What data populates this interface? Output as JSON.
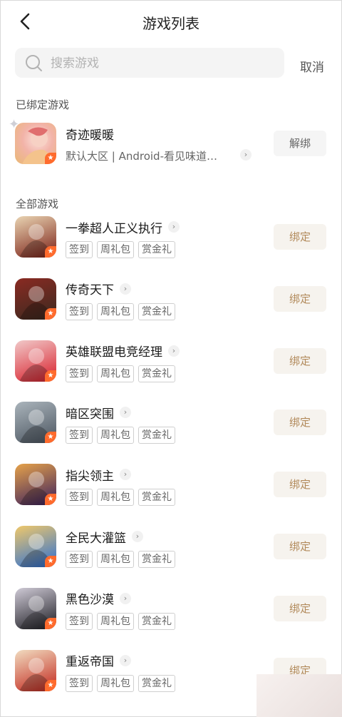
{
  "header": {
    "title": "游戏列表",
    "back_icon": "chevron-left-icon"
  },
  "search": {
    "placeholder": "搜索游戏",
    "value": "",
    "cancel_label": "取消"
  },
  "bound_section": {
    "title": "已绑定游戏",
    "game": {
      "name": "奇迹暖暖",
      "subtitle": "默认大区 | Android-看见味道…",
      "button": "解绑",
      "chevron": "›"
    }
  },
  "all_section": {
    "title": "全部游戏",
    "games": [
      {
        "name": "一拳超人正义执行",
        "chevron": "›",
        "tags": [
          "签到",
          "周礼包",
          "赏金礼"
        ],
        "button": "绑定",
        "icon_colors": [
          "#7a1f16",
          "#e9d4b2"
        ]
      },
      {
        "name": "传奇天下",
        "chevron": "›",
        "tags": [
          "签到",
          "周礼包",
          "赏金礼"
        ],
        "button": "绑定",
        "icon_colors": [
          "#3a2a20",
          "#8a2a22"
        ]
      },
      {
        "name": "英雄联盟电竞经理",
        "chevron": "›",
        "tags": [
          "签到",
          "周礼包",
          "赏金礼"
        ],
        "button": "绑定",
        "icon_colors": [
          "#d81e2a",
          "#f1c9c9"
        ]
      },
      {
        "name": "暗区突围",
        "chevron": "›",
        "tags": [
          "签到",
          "周礼包",
          "赏金礼"
        ],
        "button": "绑定",
        "icon_colors": [
          "#4b5560",
          "#aab4bb"
        ]
      },
      {
        "name": "指尖领主",
        "chevron": "›",
        "tags": [
          "签到",
          "周礼包",
          "赏金礼"
        ],
        "button": "绑定",
        "icon_colors": [
          "#3a1f5e",
          "#e6a24a"
        ]
      },
      {
        "name": "全民大灌篮",
        "chevron": "›",
        "tags": [
          "签到",
          "周礼包",
          "赏金礼"
        ],
        "button": "绑定",
        "icon_colors": [
          "#2a6fd6",
          "#f0c86a"
        ]
      },
      {
        "name": "黑色沙漠",
        "chevron": "›",
        "tags": [
          "签到",
          "周礼包",
          "赏金礼"
        ],
        "button": "绑定",
        "icon_colors": [
          "#1c1c22",
          "#cfcad6"
        ]
      },
      {
        "name": "重返帝国",
        "chevron": "›",
        "tags": [
          "签到",
          "周礼包",
          "赏金礼"
        ],
        "button": "绑定",
        "icon_colors": [
          "#c2261c",
          "#f1dcc0"
        ]
      }
    ]
  },
  "icon_badge": "★",
  "accent": {
    "bind_text": "#b28a5b",
    "bind_bg": "#f6f3ee",
    "badge": "#ff6b2d"
  }
}
